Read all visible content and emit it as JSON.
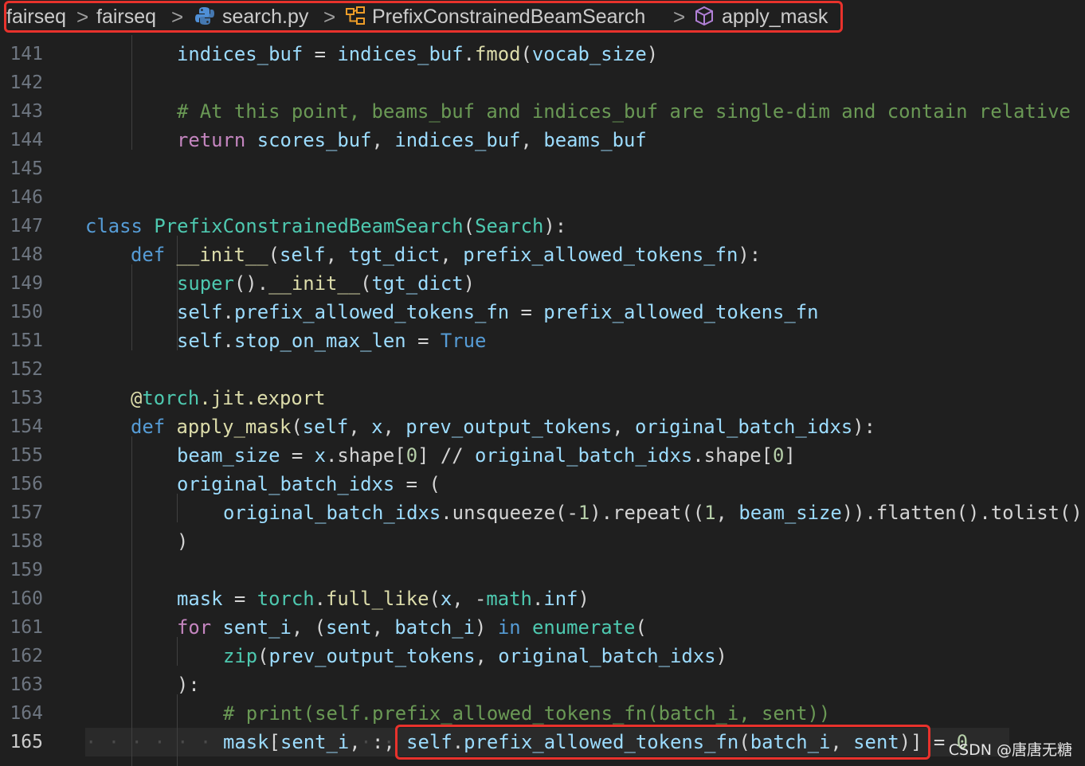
{
  "breadcrumb": {
    "items": [
      "fairseq",
      "fairseq",
      "search.py",
      "PrefixConstrainedBeamSearch",
      "apply_mask"
    ],
    "separator": ">",
    "icons": [
      "python-file-icon",
      "class-icon",
      "method-cube-icon"
    ]
  },
  "editor": {
    "active_line": "165",
    "lines": [
      {
        "num": "141"
      },
      {
        "num": "142"
      },
      {
        "num": "143"
      },
      {
        "num": "144"
      },
      {
        "num": "145"
      },
      {
        "num": "146"
      },
      {
        "num": "147"
      },
      {
        "num": "148"
      },
      {
        "num": "149"
      },
      {
        "num": "150"
      },
      {
        "num": "151"
      },
      {
        "num": "152"
      },
      {
        "num": "153"
      },
      {
        "num": "154"
      },
      {
        "num": "155"
      },
      {
        "num": "156"
      },
      {
        "num": "157"
      },
      {
        "num": "158"
      },
      {
        "num": "159"
      },
      {
        "num": "160"
      },
      {
        "num": "161"
      },
      {
        "num": "162"
      },
      {
        "num": "163"
      },
      {
        "num": "164"
      },
      {
        "num": "165"
      }
    ],
    "tokens": {
      "l141": [
        "indices_buf",
        " = ",
        "indices_buf",
        ".",
        "fmod",
        "(",
        "vocab_size",
        ")"
      ],
      "l143": [
        "# At this point, beams_buf and indices_buf are single-dim and contain relative"
      ],
      "l144": [
        "return",
        " ",
        "scores_buf",
        ", ",
        "indices_buf",
        ", ",
        "beams_buf"
      ],
      "l147": [
        "class",
        " ",
        "PrefixConstrainedBeamSearch",
        "(",
        "Search",
        "):"
      ],
      "l148": [
        "def",
        " ",
        "__init__",
        "(",
        "self",
        ", ",
        "tgt_dict",
        ", ",
        "prefix_allowed_tokens_fn",
        "):"
      ],
      "l149": [
        "super",
        "().",
        "__init__",
        "(",
        "tgt_dict",
        ")"
      ],
      "l150": [
        "self",
        ".",
        "prefix_allowed_tokens_fn",
        " = ",
        "prefix_allowed_tokens_fn"
      ],
      "l151": [
        "self",
        ".",
        "stop_on_max_len",
        " = ",
        "True"
      ],
      "l153": [
        "@",
        "torch",
        ".",
        "jit",
        ".",
        "export"
      ],
      "l154": [
        "def",
        " ",
        "apply_mask",
        "(",
        "self",
        ", ",
        "x",
        ", ",
        "prev_output_tokens",
        ", ",
        "original_batch_idxs",
        "):"
      ],
      "l155": [
        "beam_size",
        " = ",
        "x",
        ".shape[",
        "0",
        "] // ",
        "original_batch_idxs",
        ".shape[",
        "0",
        "]"
      ],
      "l156": [
        "original_batch_idxs",
        " = ("
      ],
      "l157": [
        "original_batch_idxs",
        ".unsqueeze(-",
        "1",
        ").repeat((",
        "1",
        ", ",
        "beam_size",
        ")).flatten().tolist()"
      ],
      "l158": [
        ")"
      ],
      "l160": [
        "mask",
        " = ",
        "torch",
        ".",
        "full_like",
        "(",
        "x",
        ", -",
        "math",
        ".",
        "inf",
        ")"
      ],
      "l161": [
        "for",
        " ",
        "sent_i",
        ", (",
        "sent",
        ", ",
        "batch_i",
        ") ",
        "in",
        " ",
        "enumerate",
        "("
      ],
      "l162": [
        "zip",
        "(",
        "prev_output_tokens",
        ", ",
        "original_batch_idxs",
        ")"
      ],
      "l163": [
        "):"
      ],
      "l164": [
        "# print(self.prefix_allowed_tokens_fn(batch_i, sent))"
      ],
      "l165": [
        "mask",
        "[",
        "sent_i",
        ", :, ",
        "self",
        ".",
        "prefix_allowed_tokens_fn",
        "(",
        "batch_i",
        ", ",
        "sent",
        ")",
        "]",
        " = ",
        "0"
      ]
    }
  },
  "watermark": "CSDN @唐唐无糖"
}
